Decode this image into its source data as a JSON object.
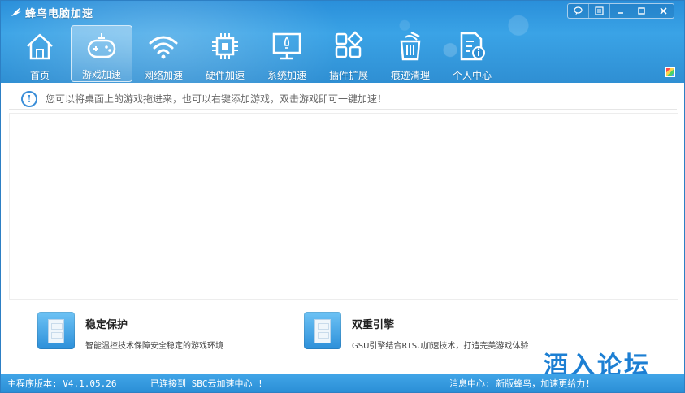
{
  "window": {
    "title": "蜂鸟电脑加速",
    "controls": [
      {
        "icon": "feedback-icon"
      },
      {
        "icon": "menu-icon"
      },
      {
        "icon": "minimize-icon"
      },
      {
        "icon": "maximize-icon"
      },
      {
        "icon": "close-icon"
      }
    ]
  },
  "toolbar": {
    "items": [
      {
        "label": "首页",
        "icon": "home-icon",
        "active": false
      },
      {
        "label": "游戏加速",
        "icon": "gamepad-icon",
        "active": true
      },
      {
        "label": "网络加速",
        "icon": "wifi-icon",
        "active": false
      },
      {
        "label": "硬件加速",
        "icon": "chip-icon",
        "active": false
      },
      {
        "label": "系统加速",
        "icon": "monitor-rocket-icon",
        "active": false
      },
      {
        "label": "插件扩展",
        "icon": "plugin-icon",
        "active": false
      },
      {
        "label": "痕迹清理",
        "icon": "trash-icon",
        "active": false
      },
      {
        "label": "个人中心",
        "icon": "profile-doc-icon",
        "active": false
      }
    ]
  },
  "tip": {
    "text": "您可以将桌面上的游戏拖进来，也可以右键添加游戏，双击游戏即可一键加速！"
  },
  "features": [
    {
      "title": "稳定保护",
      "description": "智能温控技术保障安全稳定的游戏环境"
    },
    {
      "title": "双重引擎",
      "description": "GSU引擎结合RTSU加速技术，打造完美游戏体验"
    }
  ],
  "watermark": "酒入论坛",
  "status": {
    "version": "主程序版本: V4.1.05.26",
    "connection": "已连接到 SBC云加速中心 !",
    "message": "消息中心: 新版蜂鸟，加速更给力!"
  },
  "colors": {
    "header": "#2f8fd3",
    "accent": "#3b8ed8",
    "statusbar": "#2b8fd6"
  }
}
